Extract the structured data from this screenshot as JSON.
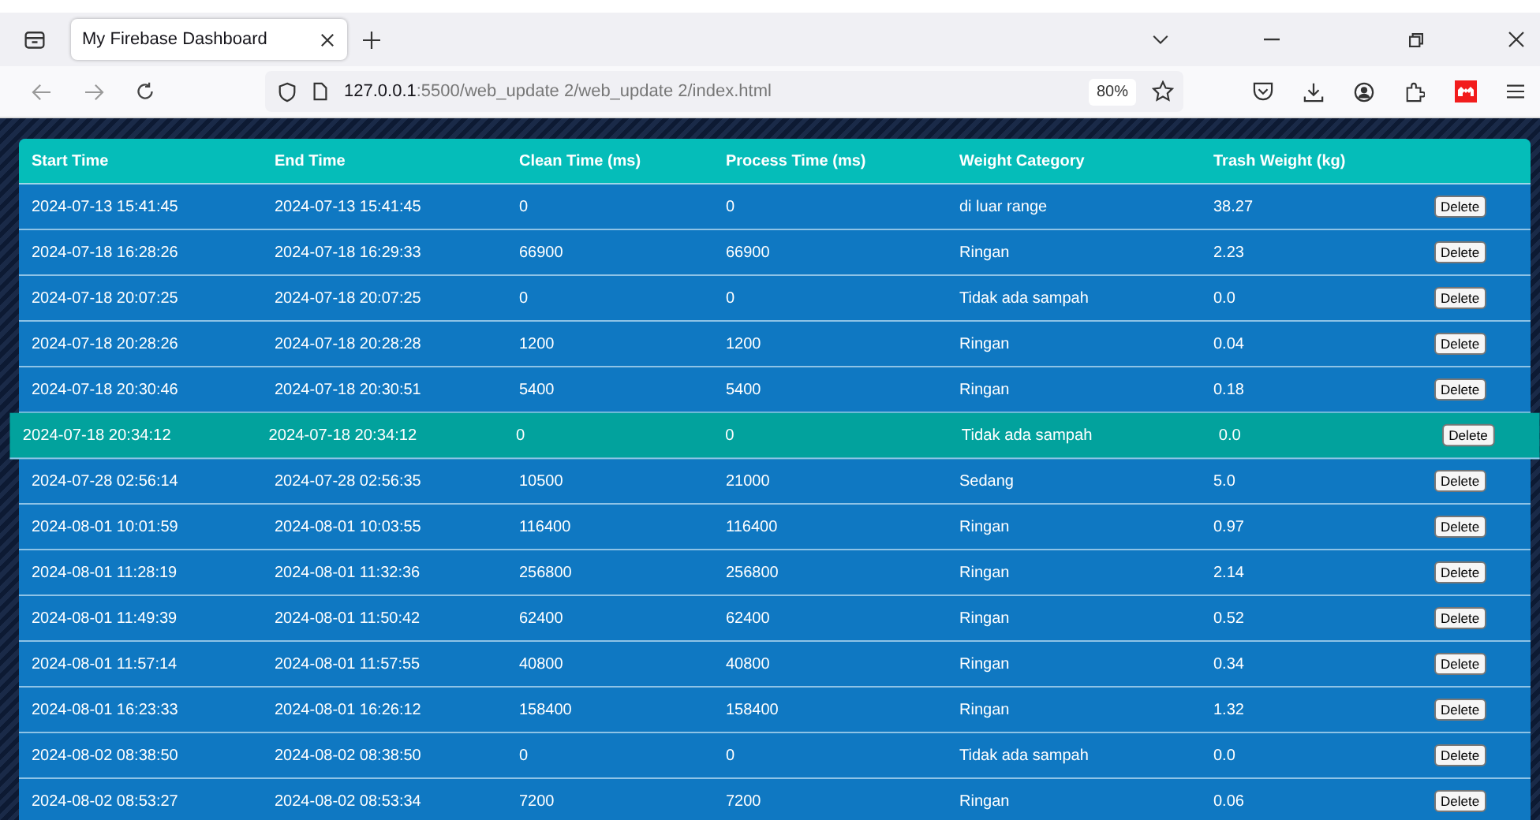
{
  "browser": {
    "tab_title": "My Firebase Dashboard",
    "url_host": "127.0.0.1",
    "url_path": ":5500/web_update 2/web_update 2/index.html",
    "zoom": "80%"
  },
  "table": {
    "columns": [
      "Start Time",
      "End Time",
      "Clean Time (ms)",
      "Process Time (ms)",
      "Weight Category",
      "Trash Weight (kg)"
    ],
    "rows": [
      {
        "cells": [
          "2024-07-13 15:41:45",
          "2024-07-13 15:41:45",
          "0",
          "0",
          "di luar range",
          "38.27"
        ],
        "action": "Delete",
        "highlighted": false
      },
      {
        "cells": [
          "2024-07-18 16:28:26",
          "2024-07-18 16:29:33",
          "66900",
          "66900",
          "Ringan",
          "2.23"
        ],
        "action": "Delete",
        "highlighted": false
      },
      {
        "cells": [
          "2024-07-18 20:07:25",
          "2024-07-18 20:07:25",
          "0",
          "0",
          "Tidak ada sampah",
          "0.0"
        ],
        "action": "Delete",
        "highlighted": false
      },
      {
        "cells": [
          "2024-07-18 20:28:26",
          "2024-07-18 20:28:28",
          "1200",
          "1200",
          "Ringan",
          "0.04"
        ],
        "action": "Delete",
        "highlighted": false
      },
      {
        "cells": [
          "2024-07-18 20:30:46",
          "2024-07-18 20:30:51",
          "5400",
          "5400",
          "Ringan",
          "0.18"
        ],
        "action": "Delete",
        "highlighted": false
      },
      {
        "cells": [
          "2024-07-18 20:34:12",
          "2024-07-18 20:34:12",
          "0",
          "0",
          "Tidak ada sampah",
          "0.0"
        ],
        "action": "Delete",
        "highlighted": true
      },
      {
        "cells": [
          "2024-07-28 02:56:14",
          "2024-07-28 02:56:35",
          "10500",
          "21000",
          "Sedang",
          "5.0"
        ],
        "action": "Delete",
        "highlighted": false
      },
      {
        "cells": [
          "2024-08-01 10:01:59",
          "2024-08-01 10:03:55",
          "116400",
          "116400",
          "Ringan",
          "0.97"
        ],
        "action": "Delete",
        "highlighted": false
      },
      {
        "cells": [
          "2024-08-01 11:28:19",
          "2024-08-01 11:32:36",
          "256800",
          "256800",
          "Ringan",
          "2.14"
        ],
        "action": "Delete",
        "highlighted": false
      },
      {
        "cells": [
          "2024-08-01 11:49:39",
          "2024-08-01 11:50:42",
          "62400",
          "62400",
          "Ringan",
          "0.52"
        ],
        "action": "Delete",
        "highlighted": false
      },
      {
        "cells": [
          "2024-08-01 11:57:14",
          "2024-08-01 11:57:55",
          "40800",
          "40800",
          "Ringan",
          "0.34"
        ],
        "action": "Delete",
        "highlighted": false
      },
      {
        "cells": [
          "2024-08-01 16:23:33",
          "2024-08-01 16:26:12",
          "158400",
          "158400",
          "Ringan",
          "1.32"
        ],
        "action": "Delete",
        "highlighted": false
      },
      {
        "cells": [
          "2024-08-02 08:38:50",
          "2024-08-02 08:38:50",
          "0",
          "0",
          "Tidak ada sampah",
          "0.0"
        ],
        "action": "Delete",
        "highlighted": false
      },
      {
        "cells": [
          "2024-08-02 08:53:27",
          "2024-08-02 08:53:34",
          "7200",
          "7200",
          "Ringan",
          "0.06"
        ],
        "action": "Delete",
        "highlighted": false
      }
    ]
  }
}
